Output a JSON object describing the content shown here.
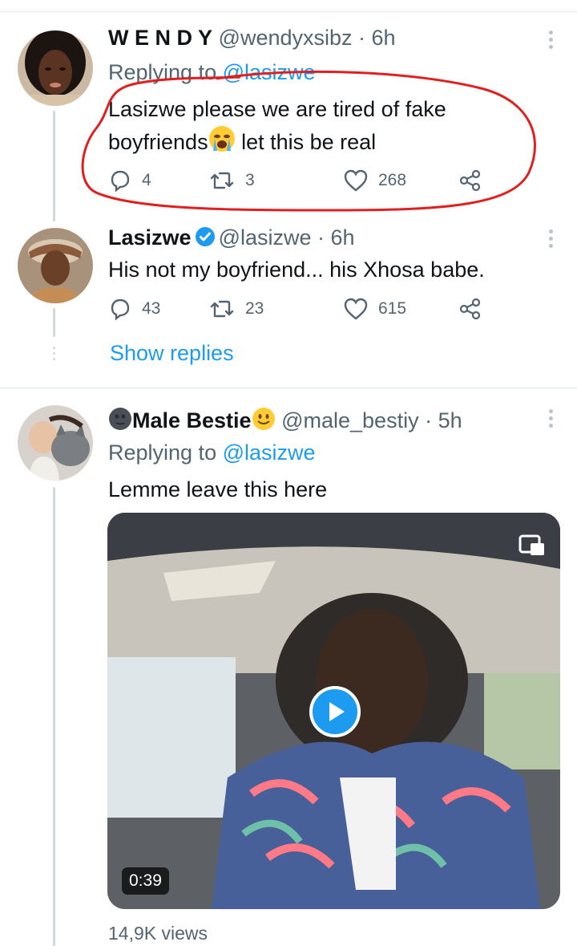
{
  "tweets": [
    {
      "display_name": "W E N D Y",
      "handle": "@wendyxsibz",
      "time": "· 6h",
      "replying_label": "Replying to",
      "replying_to": "@lasizwe",
      "text_line1": "Lasizwe please we are tired of fake",
      "text_line2a": "boyfriends",
      "text_line2b": " let this be real",
      "replies": "4",
      "retweets": "3",
      "likes": "268",
      "emoji_icon": "loudly-crying-face-emoji"
    },
    {
      "display_name": "Lasizwe",
      "handle": "@lasizwe",
      "time": "· 6h",
      "text": "His not my boyfriend... his Xhosa babe.",
      "replies": "43",
      "retweets": "23",
      "likes": "615",
      "verified": true
    },
    {
      "display_name": "Male Bestie",
      "handle": "@male_bestiy",
      "time": "· 5h",
      "replying_label": "Replying to",
      "replying_to": "@lasizwe",
      "text": "Lemme leave this here",
      "video_duration": "0:39",
      "views": "14,9K views"
    }
  ],
  "show_replies_label": "Show replies",
  "colors": {
    "accent": "#1d9bf0",
    "secondary_text": "#536471",
    "annotation_red": "#e0201f"
  },
  "icons": [
    "reply-icon",
    "retweet-icon",
    "like-icon",
    "share-icon",
    "more-icon",
    "verified-badge-icon",
    "play-icon",
    "picture-in-picture-icon"
  ]
}
